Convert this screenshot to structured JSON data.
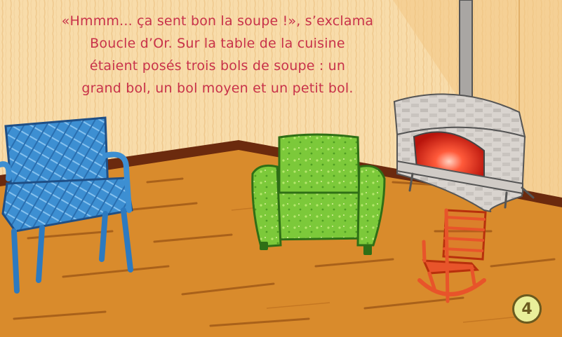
{
  "story": {
    "lines": [
      "«Hmmm... ça sent bon la soupe !», s’exclama",
      "Boucle d’Or. Sur la table de la cuisine",
      "étaient posés trois bols de soupe : un",
      "grand bol, un bol moyen et un petit bol."
    ]
  },
  "page": {
    "number": "4"
  },
  "colors": {
    "text": "#c8324a",
    "wall": "#f6d9a6",
    "floor": "#d98b2c",
    "baseboard": "#6b2a0e",
    "blue_chair": "#3d8fd2",
    "green_armchair": "#7cc93a",
    "rocking_chair": "#e8542a",
    "fire": "#e8301c",
    "page_badge": "#e9ef9a"
  },
  "icons": {
    "page_badge": "circle-badge-icon"
  }
}
